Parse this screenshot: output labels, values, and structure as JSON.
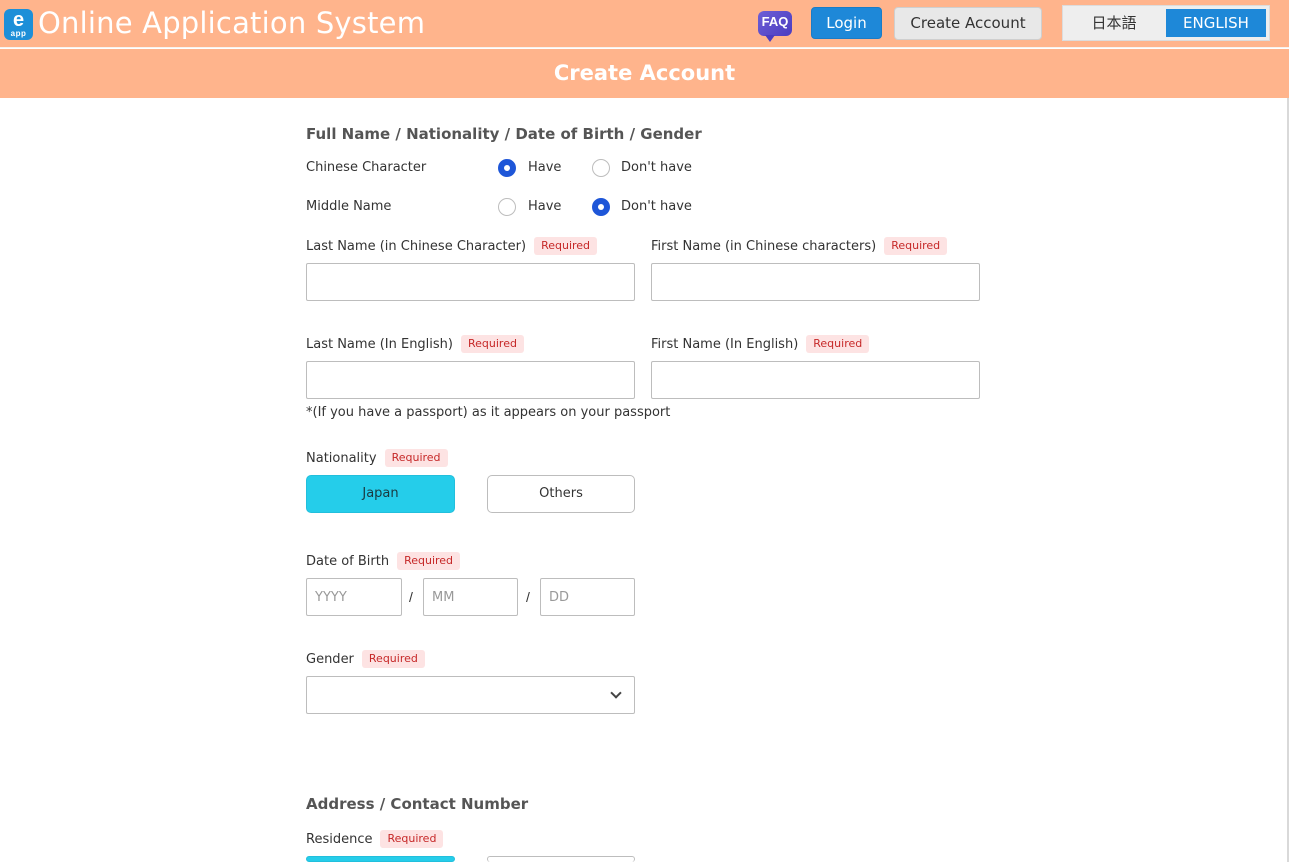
{
  "header": {
    "logo_letter": "e",
    "logo_sub": "app",
    "title": "Online Application System",
    "faq": "FAQ",
    "login": "Login",
    "create_account": "Create Account",
    "lang_jp": "日本語",
    "lang_en": "ENGLISH"
  },
  "subheader": {
    "title": "Create Account"
  },
  "section1": {
    "title": "Full Name / Nationality / Date of Birth / Gender",
    "chinese_char": {
      "label": "Chinese Character",
      "opt_have": "Have",
      "opt_dont": "Don't have",
      "selected": "Have"
    },
    "middle_name": {
      "label": "Middle Name",
      "opt_have": "Have",
      "opt_dont": "Don't have",
      "selected": "Don't have"
    },
    "last_name_cn": {
      "label": "Last Name (in Chinese Character)",
      "badge": "Required",
      "value": ""
    },
    "first_name_cn": {
      "label": "First Name (in Chinese characters)",
      "badge": "Required",
      "value": ""
    },
    "last_name_en": {
      "label": "Last Name (In English)",
      "badge": "Required",
      "value": ""
    },
    "first_name_en": {
      "label": "First Name (In English)",
      "badge": "Required",
      "value": ""
    },
    "passport_note": "*(If you have a passport) as it appears on your passport",
    "nationality": {
      "label": "Nationality",
      "badge": "Required",
      "opt_japan": "Japan",
      "opt_others": "Others",
      "selected": "Japan"
    },
    "dob": {
      "label": "Date of Birth",
      "badge": "Required",
      "yyyy": "YYYY",
      "mm": "MM",
      "dd": "DD",
      "sep": "/"
    },
    "gender": {
      "label": "Gender",
      "badge": "Required",
      "value": ""
    }
  },
  "section2": {
    "title": "Address / Contact Number",
    "residence": {
      "label": "Residence",
      "badge": "Required"
    }
  }
}
